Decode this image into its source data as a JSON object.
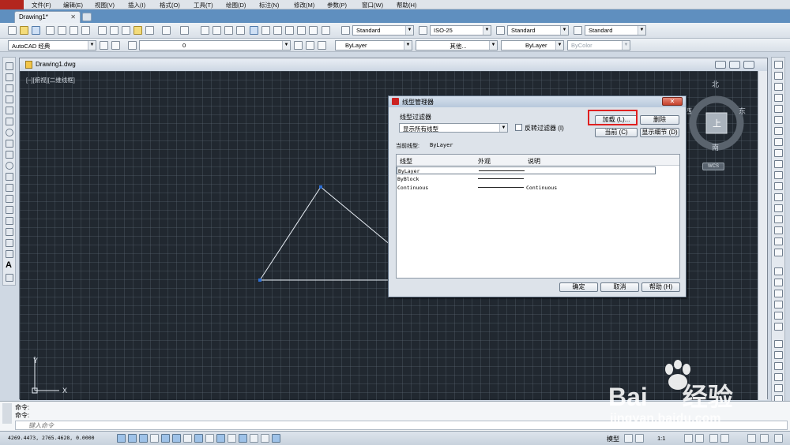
{
  "menubar": {
    "items": [
      "文件(F)",
      "编辑(E)",
      "视图(V)",
      "插入(I)",
      "格式(O)",
      "工具(T)",
      "绘图(D)",
      "标注(N)",
      "修改(M)",
      "参数(P)",
      "窗口(W)",
      "帮助(H)"
    ]
  },
  "tabs": {
    "doc_tab": "Drawing1*",
    "close": "✕"
  },
  "toolbar1": {
    "text_style": "Standard",
    "dim_style": "ISO-25",
    "table_style": "Standard",
    "mleader_style": "Standard"
  },
  "toolbar2": {
    "workspace": "AutoCAD 经典",
    "layer": "0",
    "color": "ByLayer",
    "linetype": "其他...",
    "lineweight": "ByLayer",
    "plotstyle": "ByColor"
  },
  "drawing_window": {
    "title": "Drawing1.dwg",
    "view_label": "[−][俯视][二维线框]"
  },
  "viewcube": {
    "north": "北",
    "south": "南",
    "east": "东",
    "west": "西",
    "face": "上",
    "wcs": "WCS"
  },
  "ucs": {
    "x": "X",
    "y": "Y"
  },
  "dialog": {
    "title": "线型管理器",
    "close": "✕",
    "filter_label": "线型过滤器",
    "filter_value": "显示所有线型",
    "invert_label": "反转过滤器 (I)",
    "load_button": "加载 (L)...",
    "delete_button": "删除",
    "current_button": "当前 (C)",
    "details_button": "显示细节 (D)",
    "current_linetype_label": "当前线型:",
    "current_linetype_value": "ByLayer",
    "columns": [
      "线型",
      "外观",
      "说明"
    ],
    "rows": [
      {
        "name": "ByLayer",
        "desc": ""
      },
      {
        "name": "ByBlock",
        "desc": ""
      },
      {
        "name": "Continuous",
        "desc": "Continuous"
      }
    ],
    "ok_button": "确定",
    "cancel_button": "取消",
    "help_button": "帮助 (H)"
  },
  "command": {
    "line1": "命令:",
    "line2": "命令:",
    "placeholder": "键入命令"
  },
  "statusbar": {
    "coords": "4269.4473, 2765.4628, 0.0000",
    "model": "模型",
    "scale": "1:1"
  },
  "watermark": {
    "brand": "Bai",
    "brand2": "经验",
    "url": "jingyan.baidu.com"
  }
}
